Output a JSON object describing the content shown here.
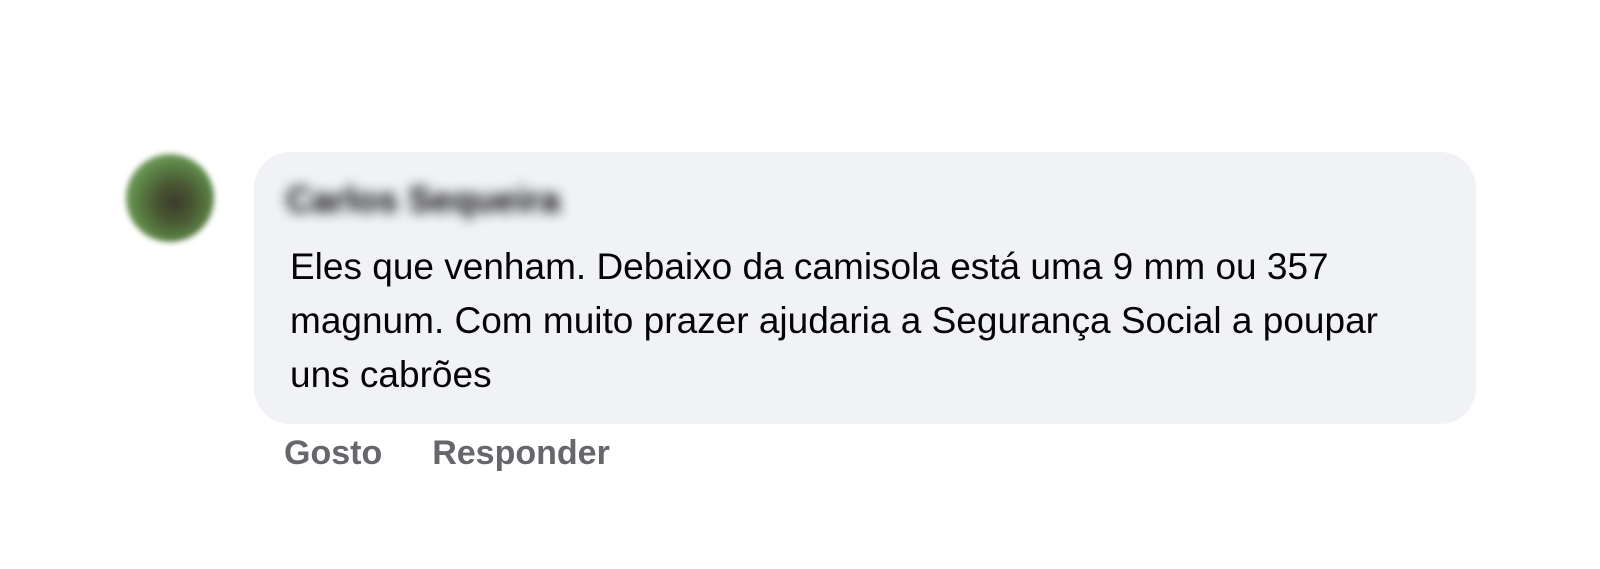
{
  "comment": {
    "author": "Carlos Sequeira",
    "text": "Eles que venham. Debaixo da camisola está uma 9 mm ou 357 magnum. Com muito prazer ajudaria a Segurança Social a poupar uns cabrões",
    "actions": {
      "like_label": "Gosto",
      "reply_label": "Responder"
    }
  },
  "colors": {
    "bubble_background": "#f0f2f5",
    "text": "#050505",
    "action_text": "#65676b"
  }
}
